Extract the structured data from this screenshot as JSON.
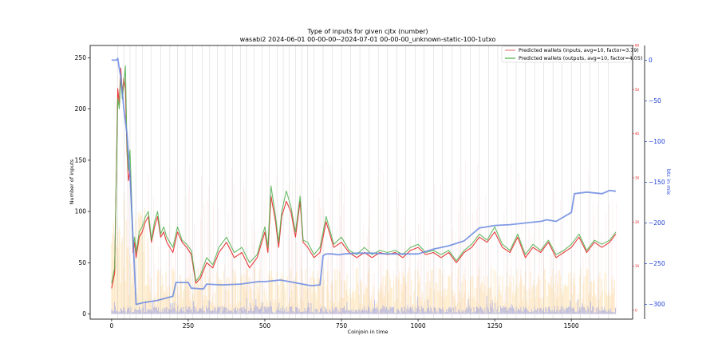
{
  "chart_data": {
    "type": "line",
    "title": "Type of inputs for given cjtx (number)",
    "subtitle": "wasabi2 2024-06-01 00-00-00--2024-07-01 00-00-00_unknown-static-100-1utxo",
    "xlabel": "Coinjoin in time",
    "ylabel": "Number of inputs",
    "y2label": "btc in mix",
    "xlim": [
      -70,
      1700
    ],
    "ylim": [
      -5,
      262
    ],
    "y2lim": [
      -318,
      18
    ],
    "y3lim": [
      -2,
      60
    ],
    "x_ticks": [
      0,
      250,
      500,
      750,
      1000,
      1250,
      1500
    ],
    "y_ticks": [
      0,
      50,
      100,
      150,
      200,
      250
    ],
    "y2_ticks": [
      0,
      -50,
      -100,
      -150,
      -200,
      -250,
      -300
    ],
    "y2_tick_labels": [
      "0",
      "−50",
      "−100",
      "−150",
      "−200",
      "−250",
      "−300"
    ],
    "y3_ticks": [
      0,
      10,
      20,
      30,
      40,
      50,
      60
    ],
    "legend_position": "top-right",
    "legend": [
      {
        "label": "Predicted wallets (inputs, avg=10, factor=3.79)",
        "color": "#e8837c"
      },
      {
        "label": "Predicted wallets (outputs, avg=10, factor=4.05)",
        "color": "#4daf4a"
      }
    ],
    "series": [
      {
        "name": "Predicted wallets (inputs, avg=10, factor=3.79)",
        "axis": "left",
        "color": "#e41a1c",
        "x": [
          0,
          10,
          20,
          25,
          30,
          35,
          40,
          45,
          50,
          55,
          60,
          65,
          70,
          75,
          80,
          90,
          100,
          110,
          120,
          130,
          140,
          150,
          160,
          170,
          180,
          190,
          200,
          215,
          230,
          245,
          260,
          275,
          290,
          310,
          330,
          350,
          375,
          400,
          425,
          450,
          475,
          500,
          510,
          520,
          535,
          545,
          555,
          570,
          585,
          600,
          615,
          625,
          640,
          660,
          680,
          700,
          725,
          750,
          775,
          800,
          825,
          850,
          875,
          900,
          925,
          950,
          975,
          1000,
          1025,
          1050,
          1075,
          1100,
          1125,
          1150,
          1175,
          1200,
          1225,
          1250,
          1275,
          1300,
          1325,
          1350,
          1375,
          1400,
          1425,
          1450,
          1475,
          1500,
          1525,
          1550,
          1575,
          1600,
          1625,
          1645
        ],
        "values": [
          25,
          40,
          220,
          205,
          240,
          215,
          230,
          220,
          160,
          130,
          140,
          110,
          60,
          70,
          55,
          75,
          80,
          90,
          95,
          70,
          85,
          95,
          75,
          80,
          70,
          65,
          60,
          80,
          70,
          65,
          58,
          30,
          35,
          50,
          45,
          60,
          70,
          55,
          60,
          45,
          55,
          80,
          60,
          115,
          90,
          65,
          95,
          110,
          100,
          75,
          110,
          70,
          65,
          55,
          60,
          90,
          65,
          70,
          60,
          55,
          60,
          55,
          60,
          58,
          60,
          55,
          62,
          65,
          58,
          60,
          55,
          60,
          50,
          60,
          65,
          75,
          70,
          80,
          65,
          60,
          75,
          55,
          65,
          60,
          70,
          55,
          60,
          65,
          75,
          60,
          70,
          65,
          70,
          78
        ]
      },
      {
        "name": "Predicted wallets (outputs, avg=10, factor=4.05)",
        "axis": "left",
        "color": "#4daf4a",
        "x": [
          0,
          10,
          20,
          25,
          30,
          35,
          40,
          45,
          50,
          55,
          60,
          65,
          70,
          75,
          80,
          90,
          100,
          110,
          120,
          130,
          140,
          150,
          160,
          170,
          180,
          190,
          200,
          215,
          230,
          245,
          260,
          275,
          290,
          310,
          330,
          350,
          375,
          400,
          425,
          450,
          475,
          500,
          510,
          520,
          535,
          545,
          555,
          570,
          585,
          600,
          615,
          625,
          640,
          660,
          680,
          700,
          725,
          750,
          775,
          800,
          825,
          850,
          875,
          900,
          925,
          950,
          975,
          1000,
          1025,
          1050,
          1075,
          1100,
          1125,
          1150,
          1175,
          1200,
          1225,
          1250,
          1275,
          1300,
          1325,
          1350,
          1375,
          1400,
          1425,
          1450,
          1475,
          1500,
          1525,
          1550,
          1575,
          1600,
          1625,
          1645
        ],
        "values": [
          30,
          45,
          210,
          200,
          232,
          210,
          225,
          242,
          165,
          140,
          160,
          115,
          65,
          75,
          60,
          80,
          85,
          95,
          100,
          72,
          90,
          100,
          78,
          85,
          75,
          70,
          65,
          85,
          72,
          68,
          62,
          32,
          38,
          55,
          48,
          65,
          75,
          60,
          65,
          50,
          58,
          85,
          65,
          125,
          95,
          70,
          100,
          120,
          105,
          80,
          115,
          72,
          70,
          58,
          65,
          95,
          68,
          75,
          62,
          58,
          65,
          58,
          62,
          60,
          62,
          58,
          65,
          68,
          60,
          62,
          58,
          62,
          52,
          62,
          68,
          78,
          72,
          85,
          68,
          62,
          78,
          58,
          68,
          62,
          72,
          58,
          62,
          68,
          78,
          62,
          72,
          68,
          72,
          80
        ]
      },
      {
        "name": "",
        "axis": "right",
        "color": "#6a89e0",
        "x": [
          0,
          15,
          20,
          25,
          30,
          35,
          40,
          50,
          60,
          70,
          75,
          80,
          100,
          150,
          200,
          210,
          250,
          260,
          300,
          310,
          360,
          420,
          480,
          500,
          550,
          580,
          650,
          680,
          690,
          700,
          720,
          740,
          760,
          800,
          850,
          900,
          950,
          1000,
          1050,
          1100,
          1150,
          1200,
          1220,
          1250,
          1300,
          1350,
          1400,
          1420,
          1450,
          1500,
          1510,
          1550,
          1600,
          1625,
          1645
        ],
        "values": [
          0,
          0,
          2,
          -10,
          -20,
          -40,
          -60,
          -90,
          -140,
          -220,
          -260,
          -300,
          -298,
          -295,
          -290,
          -273,
          -273,
          -280,
          -281,
          -275,
          -276,
          -275,
          -272,
          -272,
          -270,
          -272,
          -277,
          -276,
          -240,
          -238,
          -238,
          -239,
          -238,
          -237,
          -237,
          -238,
          -238,
          -238,
          -232,
          -228,
          -222,
          -206,
          -205,
          -203,
          -202,
          -200,
          -198,
          -196,
          -198,
          -187,
          -164,
          -162,
          -164,
          -160,
          -161
        ]
      }
    ]
  }
}
